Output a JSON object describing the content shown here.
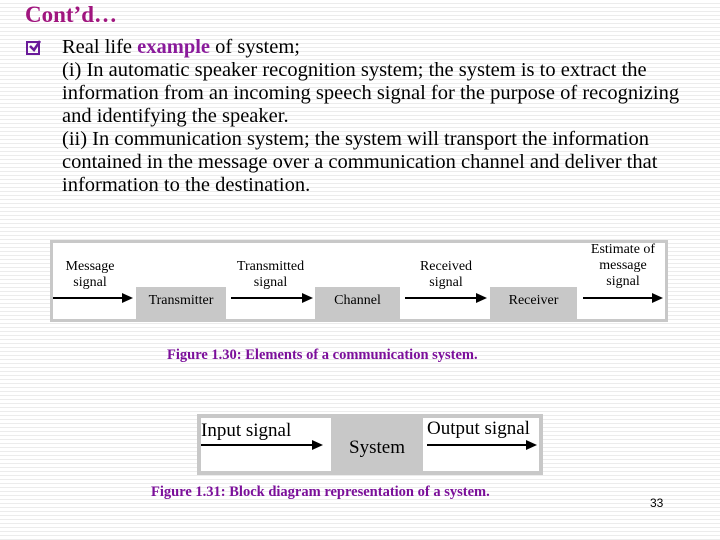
{
  "slide": {
    "title": "Cont’d…",
    "bullet": {
      "icon": "checkbox-checked-icon",
      "prefix": "Real life ",
      "highlight": "example",
      "suffix": " of system;"
    },
    "paragraph_1": "(i) In automatic speaker recognition system; the system is to extract the information from an incoming speech signal for the purpose of recognizing and identifying the speaker.",
    "paragraph_2": "(ii) In communication system; the system will transport the information contained in the message over a communication channel and deliver that information to the destination.",
    "page_number": "33"
  },
  "figure_1": {
    "labels": {
      "message_signal": "Message signal",
      "transmitted_signal": "Transmitted signal",
      "received_signal": "Received signal",
      "estimate": "Estimate of message signal"
    },
    "blocks": {
      "transmitter": "Transmitter",
      "channel": "Channel",
      "receiver": "Receiver"
    },
    "caption": "Figure 1.30: Elements of a communication system."
  },
  "figure_2": {
    "input": "Input signal",
    "system": "System",
    "output": "Output signal",
    "caption": "Figure 1.31: Block diagram representation of a system."
  },
  "colors": {
    "title": "#a0157e",
    "highlight": "#8a1a9b",
    "caption": "#7b0f9a",
    "block_fill": "#c8c8c8"
  }
}
